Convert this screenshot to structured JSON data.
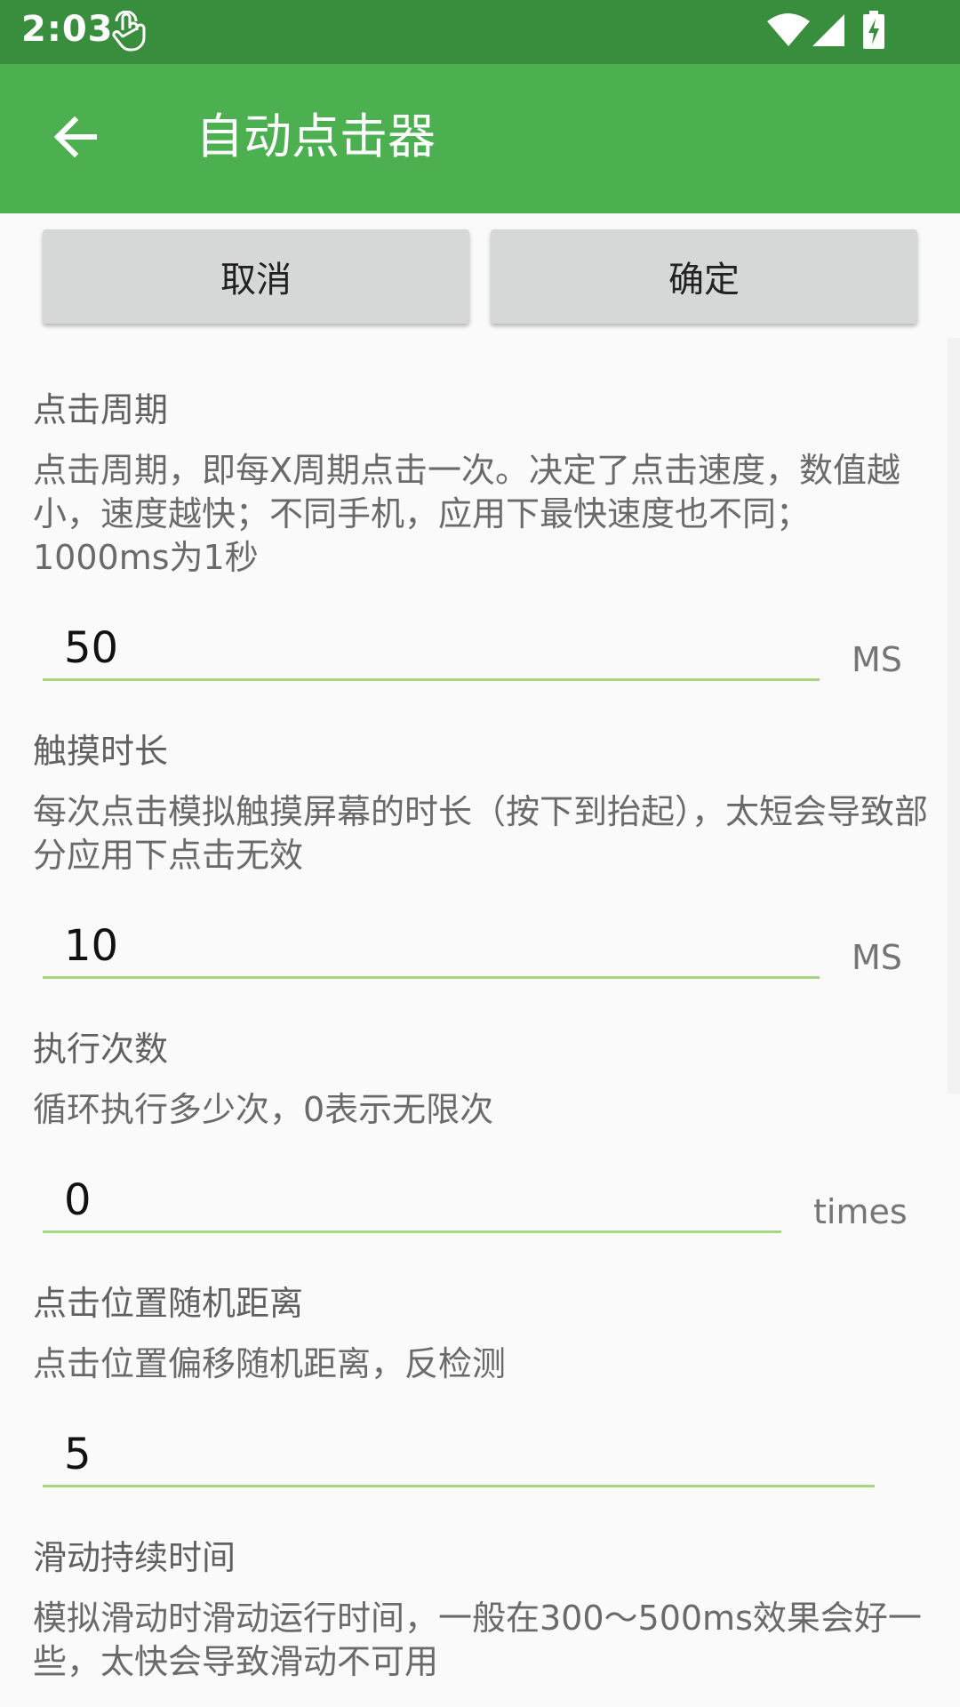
{
  "status_bar": {
    "time": "2:03"
  },
  "app_bar": {
    "title": "自动点击器"
  },
  "buttons": {
    "cancel": "取消",
    "ok": "确定"
  },
  "sections": [
    {
      "title": "点击周期",
      "desc": "点击周期，即每X周期点击一次。决定了点击速度，数值越小，速度越快；不同手机，应用下最快速度也不同；1000ms为1秒",
      "value": "50",
      "unit": "MS"
    },
    {
      "title": "触摸时长",
      "desc": "每次点击模拟触摸屏幕的时长（按下到抬起），太短会导致部分应用下点击无效",
      "value": "10",
      "unit": "MS"
    },
    {
      "title": "执行次数",
      "desc": "循环执行多少次，0表示无限次",
      "value": "0",
      "unit": "times"
    },
    {
      "title": "点击位置随机距离",
      "desc": "点击位置偏移随机距离，反检测",
      "value": "5"
    },
    {
      "title": "滑动持续时间",
      "desc": "模拟滑动时滑动运行时间，一般在300～500ms效果会好一些，太快会导致滑动不可用"
    }
  ],
  "colors": {
    "status_bar": "#388e3c",
    "app_bar": "#4caf50",
    "field_underline": "#a5d77f"
  }
}
